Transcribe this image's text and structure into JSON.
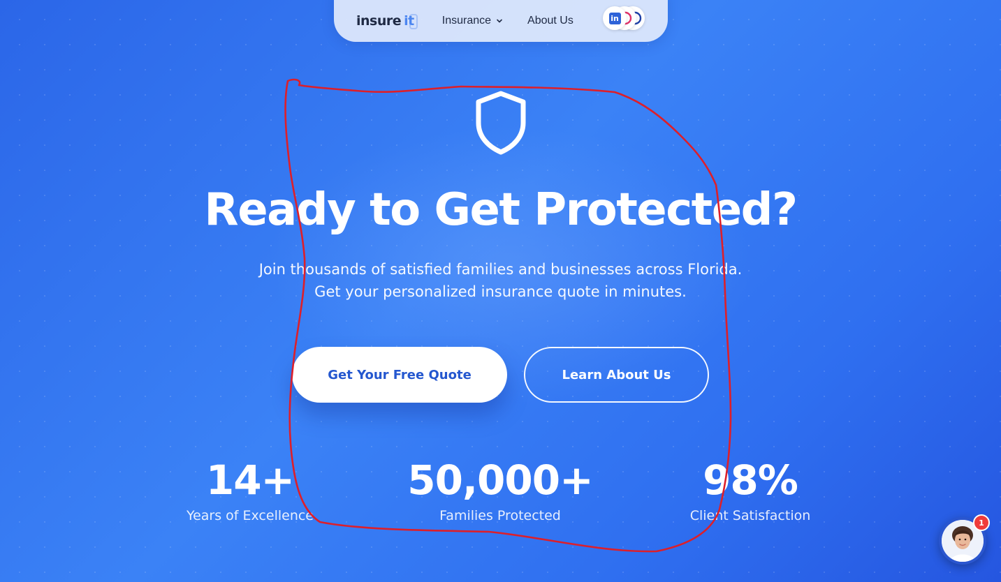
{
  "nav": {
    "logo_text": "insure",
    "logo_accent": "it",
    "insurance_label": "Insurance",
    "about_label": "About Us",
    "social_icons": [
      "linkedin-icon",
      "instagram-icon",
      "facebook-icon"
    ],
    "linkedin_glyph": "in"
  },
  "hero": {
    "icon": "shield-icon",
    "headline": "Ready to Get Protected?",
    "subtitle_line1": "Join thousands of satisfied families and businesses across Florida.",
    "subtitle_line2": "Get your personalized insurance quote in minutes.",
    "primary_button": "Get Your Free Quote",
    "secondary_button": "Learn About Us"
  },
  "stats": [
    {
      "value": "14+",
      "label": "Years of Excellence"
    },
    {
      "value": "50,000+",
      "label": "Families Protected"
    },
    {
      "value": "98%",
      "label": "Client Satisfaction"
    }
  ],
  "chat": {
    "badge_count": "1",
    "icon": "chat-avatar-icon"
  },
  "colors": {
    "background_start": "#2b66e8",
    "background_end": "#2556e0",
    "primary_text": "#ffffff",
    "button_text_blue": "#2457cf",
    "annotation_red": "#dd1f2a",
    "badge_red": "#ef3b3b"
  }
}
